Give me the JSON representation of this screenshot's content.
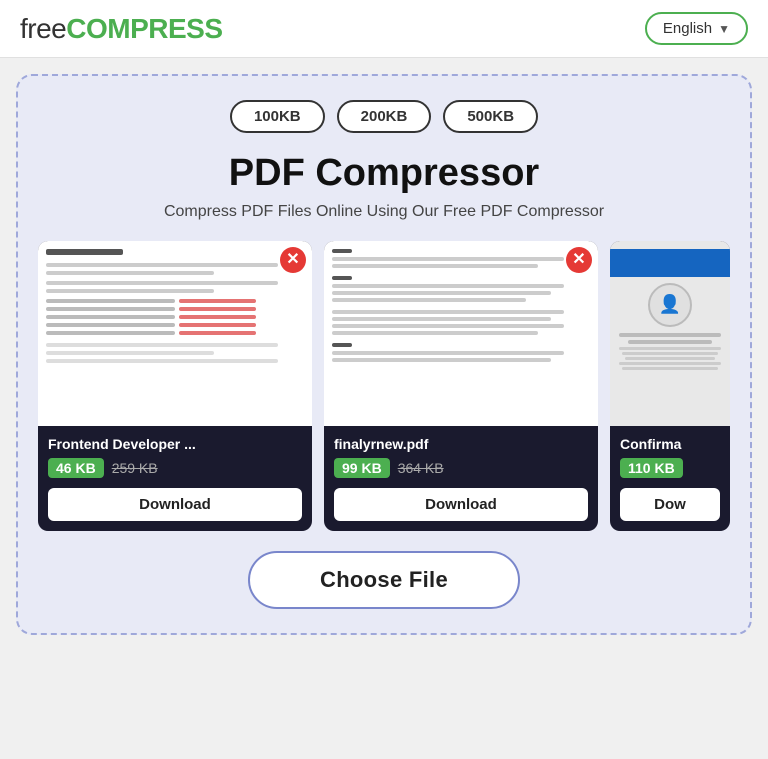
{
  "header": {
    "logo_free": "free",
    "logo_compress": "COMPRESS",
    "lang_label": "English",
    "lang_chevron": "▼"
  },
  "size_options": [
    "100KB",
    "200KB",
    "500KB"
  ],
  "title": "PDF Compressor",
  "subtitle": "Compress PDF Files Online Using Our Free PDF Compressor",
  "cards": [
    {
      "filename": "Frontend Developer ...",
      "size_new": "46 KB",
      "size_old": "259 KB",
      "download_label": "Download",
      "type": "doc"
    },
    {
      "filename": "finalyrnew.pdf",
      "size_new": "99 KB",
      "size_old": "364 KB",
      "download_label": "Download",
      "type": "text"
    },
    {
      "filename": "Confirma",
      "size_new": "110 KB",
      "size_old": "",
      "download_label": "Dow",
      "type": "cert"
    }
  ],
  "choose_file_label": "Choose File"
}
